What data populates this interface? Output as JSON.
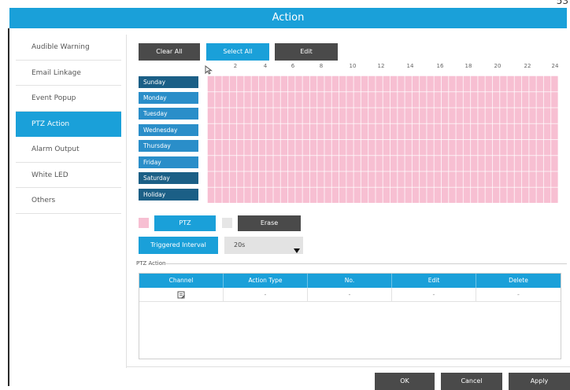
{
  "corner_text": "53",
  "window": {
    "title": "Action"
  },
  "sidebar": {
    "items": [
      {
        "label": "Audible Warning"
      },
      {
        "label": "Email Linkage"
      },
      {
        "label": "Event Popup"
      },
      {
        "label": "PTZ Action"
      },
      {
        "label": "Alarm Output"
      },
      {
        "label": "White LED"
      },
      {
        "label": "Others"
      }
    ],
    "active_index": 3
  },
  "schedule": {
    "buttons": {
      "clear_all": "Clear All",
      "select_all": "Select All",
      "edit": "Edit"
    },
    "hours": [
      "2",
      "4",
      "6",
      "8",
      "10",
      "12",
      "14",
      "16",
      "18",
      "20",
      "22",
      "24"
    ],
    "days": [
      "Sunday",
      "Monday",
      "Tuesday",
      "Wednesday",
      "Thursday",
      "Friday",
      "Saturday",
      "Holiday"
    ],
    "grid_color": "#f7bfd2"
  },
  "legend": {
    "ptz_label": "PTZ",
    "erase_label": "Erase",
    "ptz_color": "#f7bfd2",
    "erase_color": "#e6e6e6"
  },
  "triggered_interval": {
    "label": "Triggered Interval",
    "value": "20s"
  },
  "ptz_action": {
    "section_label": "PTZ Action",
    "columns": [
      "Channel",
      "Action Type",
      "No.",
      "Edit",
      "Delete"
    ],
    "rows": [
      {
        "channel_icon": "edit-channel-icon",
        "action_type": "-",
        "no": "-",
        "edit": "-",
        "delete": "-"
      }
    ]
  },
  "footer": {
    "ok": "OK",
    "cancel": "Cancel",
    "apply": "Apply"
  },
  "colors": {
    "accent": "#1aa0d9",
    "dark_button": "#4a4a4a",
    "day_dark": "#1b5f86",
    "day_light": "#2a8ec9"
  }
}
